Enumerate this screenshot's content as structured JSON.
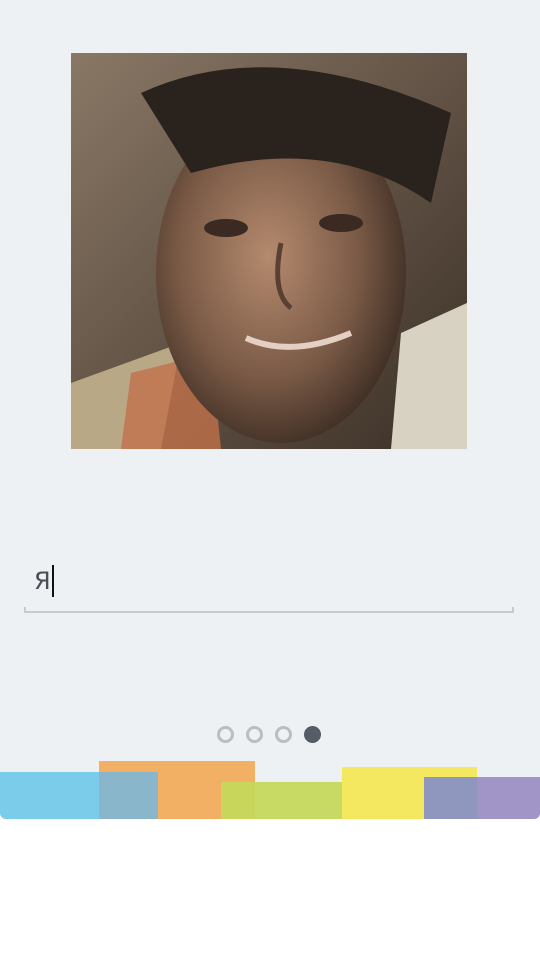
{
  "profile": {
    "photo_icon": "user-photo",
    "name_input_value": "Я"
  },
  "pager": {
    "total_pages": 4,
    "current_page": 4
  },
  "colors": {
    "background": "#edf1f4",
    "dot_inactive": "#b7bec4",
    "dot_active": "#555d66",
    "band": [
      "#74c9e9",
      "#f2a854",
      "#c6d85c",
      "#f3e860",
      "#9b98c8"
    ]
  }
}
